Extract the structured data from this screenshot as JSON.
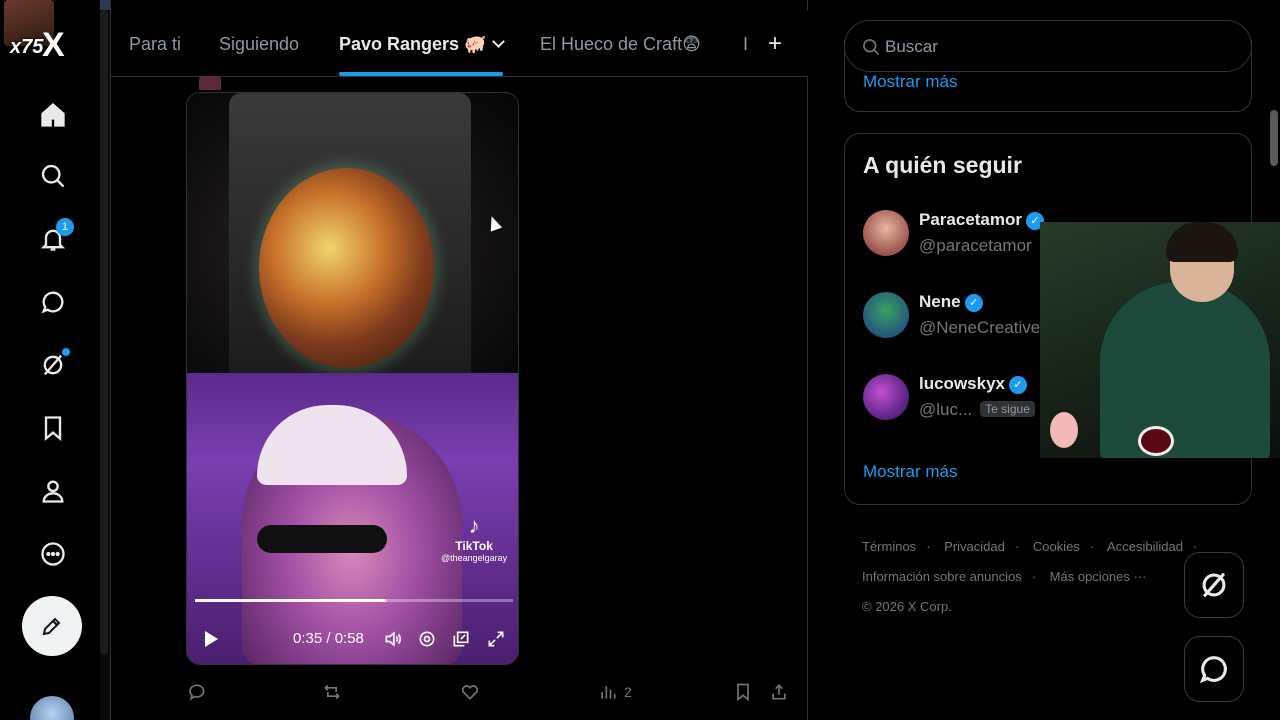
{
  "overlay": {
    "multiplier": "x75"
  },
  "nav": {
    "logo": "X",
    "notifications_badge": "1"
  },
  "tabs": [
    {
      "label": "Para ti"
    },
    {
      "label": "Siguiendo"
    },
    {
      "label": "Pavo Rangers 🐖"
    },
    {
      "label": "El Hueco de Craft😨"
    },
    {
      "label": "I"
    }
  ],
  "add_tab": "+",
  "video": {
    "time": "0:35 / 0:58",
    "progress": 0.6,
    "watermark_brand": "TikTok",
    "watermark_handle": "@theangelgaray"
  },
  "actions": {
    "views": "2"
  },
  "search": {
    "placeholder": "Buscar"
  },
  "prev_section": {
    "show_more": "Mostrar más"
  },
  "who_to_follow": {
    "title": "A quién seguir",
    "users": [
      {
        "name": "Paracetamor",
        "handle": "@paracetamor",
        "follows_you": ""
      },
      {
        "name": "Nene",
        "handle": "@NeneCreative",
        "follows_you": ""
      },
      {
        "name": "lucowskyx",
        "handle": "@luc...",
        "follows_you": "Te sigue"
      }
    ],
    "show_more": "Mostrar más"
  },
  "footer": {
    "links": [
      "Términos",
      "Privacidad",
      "Cookies",
      "Accesibilidad",
      "Información sobre anuncios",
      "Más opciones ···"
    ],
    "copyright": "© 2026 X Corp."
  },
  "colors": {
    "accent": "#1d9bf0",
    "background": "#000000"
  }
}
